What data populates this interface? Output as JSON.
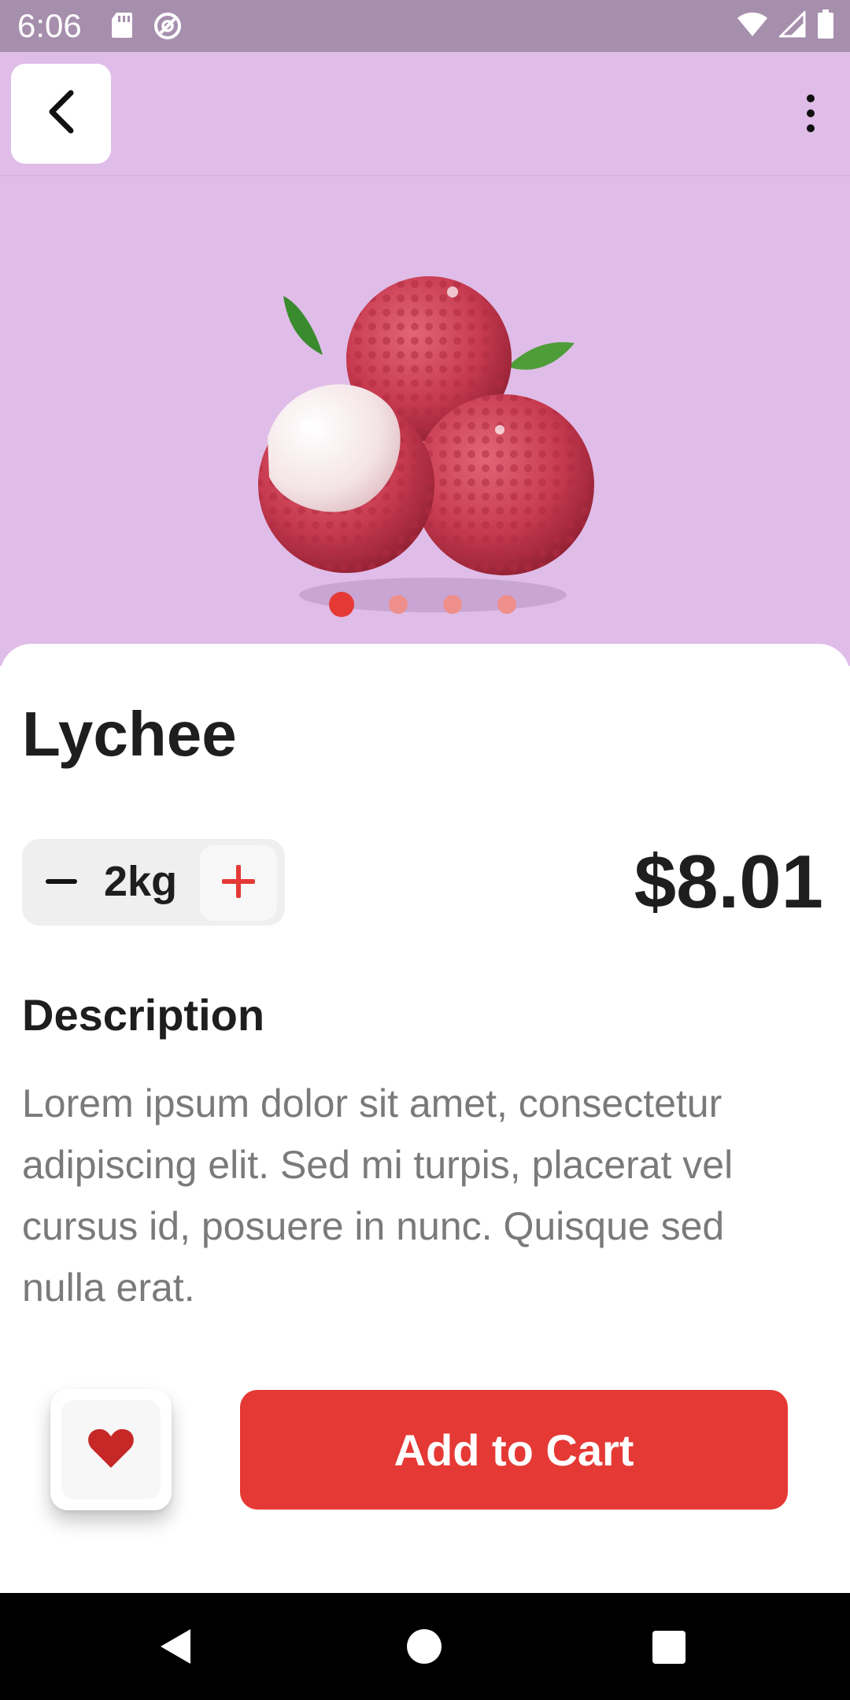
{
  "status_bar": {
    "time": "6:06",
    "left_icons": [
      "sd-card-icon",
      "do-not-disturb-icon"
    ],
    "right_icons": [
      "wifi-icon",
      "cell-signal-icon",
      "battery-icon"
    ]
  },
  "header": {
    "back_icon": "chevron-left-icon",
    "menu_icon": "more-vert-icon"
  },
  "carousel": {
    "image": "lychee-fruit-image",
    "slide_count": 4,
    "active_index": 0
  },
  "product": {
    "name": "Lychee",
    "quantity": "2kg",
    "price": "$8.01",
    "description_heading": "Description",
    "description": "Lorem ipsum dolor sit amet, consectetur adipiscing elit. Sed mi turpis, placerat vel cursus id, posuere in nunc. Quisque sed nulla erat."
  },
  "actions": {
    "favorite_icon": "heart-icon",
    "add_to_cart": "Add to Cart"
  },
  "colors": {
    "hero_background": "#dfbde8",
    "status_bar": "#a68ead",
    "accent": "#e53935",
    "dot_inactive": "#ef8f8b",
    "title_text": "#1e1e1e",
    "body_text": "#7a7a7a"
  },
  "nav_bar": {
    "buttons": [
      "nav-back-icon",
      "nav-home-icon",
      "nav-recents-icon"
    ]
  }
}
